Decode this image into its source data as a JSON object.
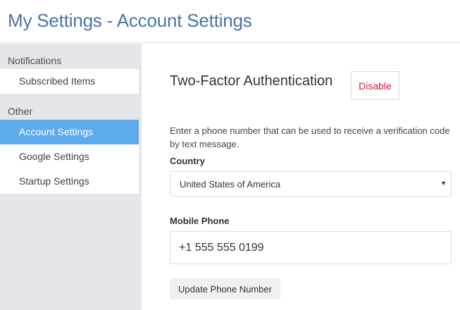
{
  "header": {
    "title": "My Settings - Account Settings"
  },
  "sidebar": {
    "groups": [
      {
        "label": "Notifications",
        "items": [
          {
            "label": "Subscribed Items",
            "active": false
          }
        ]
      },
      {
        "label": "Other",
        "items": [
          {
            "label": "Account Settings",
            "active": true
          },
          {
            "label": "Google Settings",
            "active": false
          },
          {
            "label": "Startup Settings",
            "active": false
          }
        ]
      }
    ]
  },
  "main": {
    "section_title": "Two-Factor Authentication",
    "disable_button": "Disable",
    "help_text": "Enter a phone number that can be used to receive a verification code by text message.",
    "country_label": "Country",
    "country_value": "United States of America",
    "mobile_label": "Mobile Phone",
    "mobile_value": "+1 555 555 0199",
    "update_button": "Update Phone Number"
  },
  "colors": {
    "title": "#4a74a8",
    "sidebar_bg": "#e4e6e9",
    "active_item_bg": "#5eabeb",
    "disable_text": "#d6173a"
  }
}
